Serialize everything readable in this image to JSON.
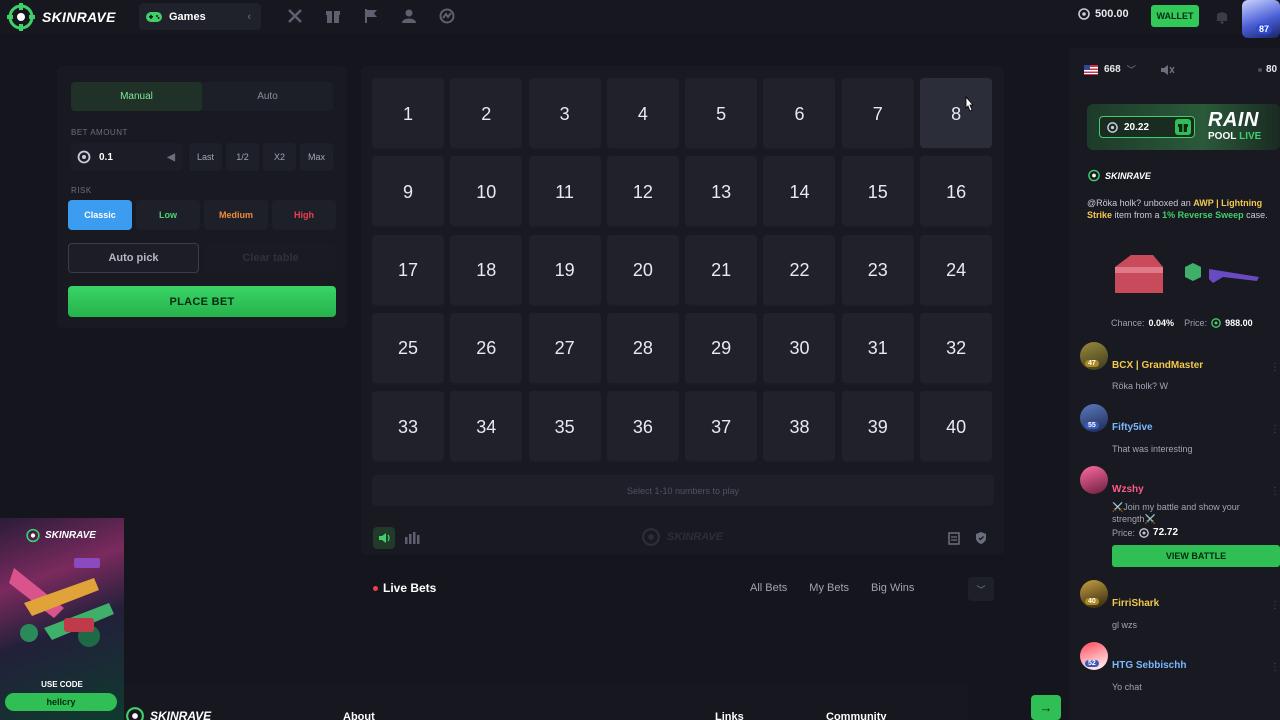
{
  "header": {
    "brand": "SKINRAVE",
    "games_label": "Games",
    "balance": "500.00",
    "wallet_label": "WALLET",
    "avatar_level": "87"
  },
  "controls": {
    "mode_tabs": [
      "Manual",
      "Auto"
    ],
    "active_mode": "Manual",
    "bet_amount_label": "BET AMOUNT",
    "bet_amount_value": "0.1",
    "quick_buttons": [
      "Last",
      "1/2",
      "X2",
      "Max"
    ],
    "risk_label": "RISK",
    "risk_options": [
      "Classic",
      "Low",
      "Medium",
      "High"
    ],
    "active_risk": "Classic",
    "auto_pick_label": "Auto pick",
    "clear_table_label": "Clear table",
    "place_bet_label": "PLACE BET"
  },
  "board": {
    "numbers": [
      "1",
      "2",
      "3",
      "4",
      "5",
      "6",
      "7",
      "8",
      "9",
      "10",
      "11",
      "12",
      "13",
      "14",
      "15",
      "16",
      "17",
      "18",
      "19",
      "20",
      "21",
      "22",
      "23",
      "24",
      "25",
      "26",
      "27",
      "28",
      "29",
      "30",
      "31",
      "32",
      "33",
      "34",
      "35",
      "36",
      "37",
      "38",
      "39",
      "40"
    ],
    "hint": "Select 1-10 numbers to play",
    "watermark": "SKINRAVE"
  },
  "live_bets": {
    "title": "Live Bets",
    "tabs": [
      "All Bets",
      "My Bets",
      "Big Wins"
    ]
  },
  "footer": {
    "brand": "SKINRAVE",
    "columns": [
      "About",
      "Links",
      "Community"
    ]
  },
  "promo": {
    "brand": "SKINRAVE",
    "use_code": "USE CODE",
    "code": "hellcry"
  },
  "sidebar": {
    "flag_count": "668",
    "online": "80",
    "rain_amount": "20.22",
    "rain_title": "RAIN",
    "rain_pool": "POOL",
    "rain_live": "LIVE",
    "unbox": {
      "brand": "SKINRAVE",
      "user": "@Röka holk?",
      "verb": "unboxed an",
      "item": "AWP | Lightning Strike",
      "item_suffix": "item from a",
      "case": "1% Reverse Sweep",
      "case_suffix": "case.",
      "chance_label": "Chance:",
      "chance_value": "0.04%",
      "price_label": "Price:",
      "price_value": "988.00"
    },
    "messages": [
      {
        "name": "BCX | GrandMaster",
        "level": "47",
        "text": "Röka holk? W",
        "color": "#f2c94c"
      },
      {
        "name": "Fifty5ive",
        "level": "55",
        "text": "That was interesting",
        "color": "#7ab8ff"
      },
      {
        "name": "Wzshy",
        "level": "",
        "text": "⚔️Join my battle and show your strength⚔️",
        "color": "#ff5a8a"
      },
      {
        "name": "FirriShark",
        "level": "40",
        "text": "gl wzs",
        "color": "#f2c94c"
      },
      {
        "name": "HTG Sebbischh",
        "level": "52",
        "text": "Yo chat",
        "color": "#7ab8ff"
      }
    ],
    "battle": {
      "price_label": "Price:",
      "price_value": "72.72",
      "button": "VIEW BATTLE"
    }
  },
  "colors": {
    "accent_green": "#2fbf55",
    "classic_blue": "#3b9cf0",
    "medium_orange": "#f08a3a",
    "high_red": "#ef3f4f"
  }
}
